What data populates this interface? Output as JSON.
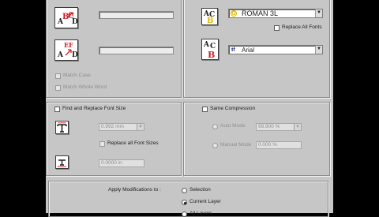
{
  "find_replace": {
    "find_icon_letters": {
      "a": "A",
      "b": "B",
      "c": "C",
      "d": "D"
    },
    "replace_icon_letters": {
      "a": "A",
      "d": "D",
      "e": "E",
      "f": "F"
    },
    "find_value": "",
    "replace_value": "",
    "match_case_label": "Match Case",
    "match_whole_word_label": "Match Whole Word"
  },
  "font": {
    "shx_icon_letters": {
      "a": "A",
      "c": "C",
      "b": "B"
    },
    "ttf_icon_letters": {
      "a": "A",
      "c": "C",
      "b": "B"
    },
    "shx_badge": "G",
    "shx_font": "ROMAN 3L",
    "replace_all_fonts_label": "Replace All Fonts",
    "ttf_badge": "ŧf",
    "ttf_font": "Arial"
  },
  "font_size": {
    "checkbox_label": "Find and Replace Font Size",
    "size_value": "0.992 mm",
    "replace_all_sizes_label": "Replace all Font Sizes",
    "second_value": "0.0000 in"
  },
  "compression": {
    "checkbox_label": "Same Compression",
    "auto_mode_label": "Auto Mode",
    "auto_value": "99.900 %",
    "manual_mode_label": "Manual Mode",
    "manual_value": "0.000 %"
  },
  "apply": {
    "label": "Apply Modifications to :",
    "options": [
      "Selection",
      "Current Layer",
      "All Layers"
    ]
  },
  "colors": {
    "dialog_bg": "#c6c6c6",
    "accent_red": "#d0202a",
    "accent_yellow": "#e0b800"
  }
}
